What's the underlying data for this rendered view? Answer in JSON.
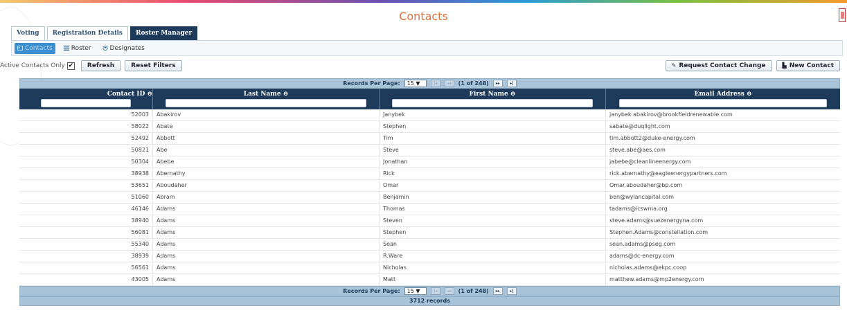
{
  "page": {
    "title": "Contacts"
  },
  "tabs": [
    {
      "label": "Voting"
    },
    {
      "label": "Registration Details"
    },
    {
      "label": "Roster Manager"
    }
  ],
  "subnav": [
    {
      "label": "Contacts",
      "icon": "contact-card-icon"
    },
    {
      "label": "Roster",
      "icon": "list-icon"
    },
    {
      "label": "Designates",
      "icon": "user-circle-icon"
    }
  ],
  "toolbar": {
    "active_only_label": "Active Contacts Only",
    "refresh_label": "Refresh",
    "reset_filters_label": "Reset Filters",
    "request_change_label": "Request Contact Change",
    "new_contact_label": "New Contact"
  },
  "pager": {
    "records_per_page_label": "Records Per Page:",
    "per_page_value": "15 ▼",
    "first_glyph": "|◂",
    "prev_glyph": "◂◂",
    "page_status": "(1 of 248)",
    "next_glyph": "▸▸",
    "last_glyph": "▸|"
  },
  "columns": [
    {
      "label": "Contact ID ⊖"
    },
    {
      "label": "Last Name ⊖"
    },
    {
      "label": "First Name ⊖"
    },
    {
      "label": "Email Address ⊖"
    }
  ],
  "rows": [
    {
      "id": "52003",
      "last": "Abakirov",
      "first": "Janybek",
      "email": "janybek.abakirov@brookfieldrenewable.com"
    },
    {
      "id": "58022",
      "last": "Abate",
      "first": "Stephen",
      "email": "sabate@duqlight.com"
    },
    {
      "id": "52492",
      "last": "Abbott",
      "first": "Tim",
      "email": "tim.abbott2@duke-energy.com"
    },
    {
      "id": "50821",
      "last": "Abe",
      "first": "Steve",
      "email": "steve.abe@aes.com"
    },
    {
      "id": "50304",
      "last": "Abebe",
      "first": "Jonathan",
      "email": "jabebe@cleanlineenergy.com"
    },
    {
      "id": "38938",
      "last": "Abernathy",
      "first": "Rick",
      "email": "rick.abernathy@eagleenergypartners.com"
    },
    {
      "id": "53651",
      "last": "Aboudaher",
      "first": "Omar",
      "email": "Omar.aboudaher@bp.com"
    },
    {
      "id": "51060",
      "last": "Abram",
      "first": "Benjamin",
      "email": "ben@wylancapital.com"
    },
    {
      "id": "46146",
      "last": "Adams",
      "first": "Thomas",
      "email": "tadams@icswma.org"
    },
    {
      "id": "38940",
      "last": "Adams",
      "first": "Steven",
      "email": "steve.adams@suezenergyna.com"
    },
    {
      "id": "56081",
      "last": "Adams",
      "first": "Stephen",
      "email": "Stephen.Adams@constellation.com"
    },
    {
      "id": "55340",
      "last": "Adams",
      "first": "Sean",
      "email": "sean.adams@pseg.com"
    },
    {
      "id": "38939",
      "last": "Adams",
      "first": "R.Ware",
      "email": "adams@dc-energy.com"
    },
    {
      "id": "56561",
      "last": "Adams",
      "first": "Nicholas",
      "email": "nicholas.adams@ekpc.coop"
    },
    {
      "id": "43005",
      "last": "Adams",
      "first": "Matt",
      "email": "matthew.adams@mp2energy.com"
    }
  ],
  "footer": {
    "records_text": "3712 records"
  }
}
